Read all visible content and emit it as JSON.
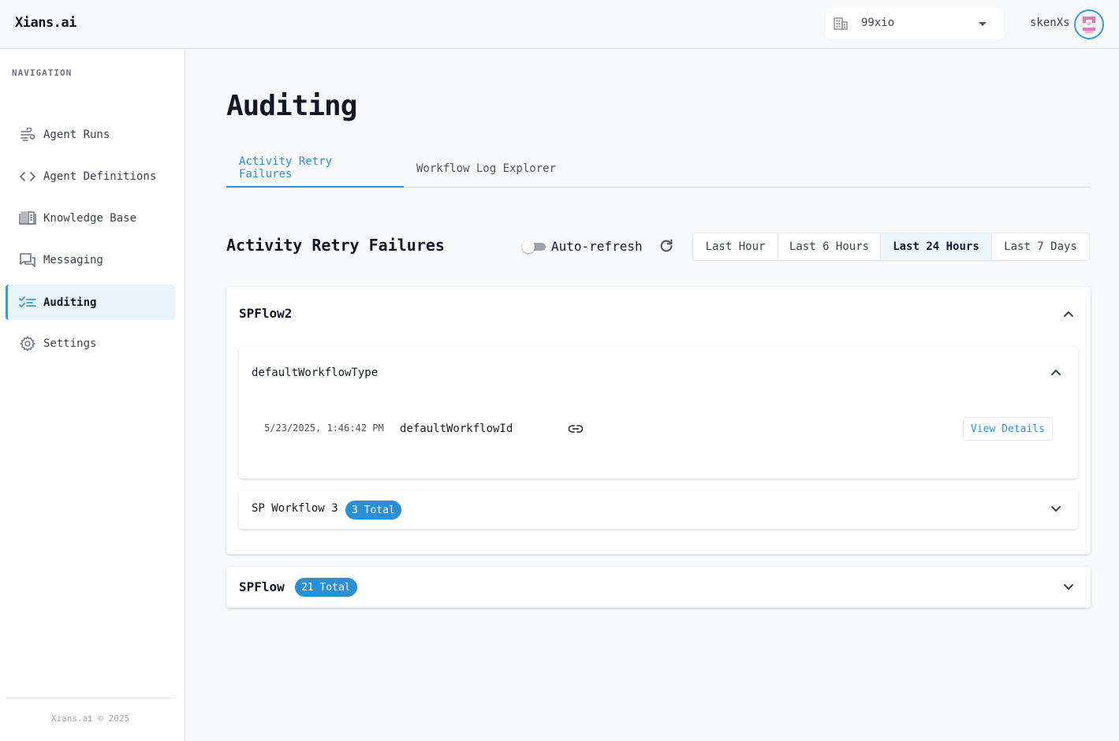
{
  "header": {
    "brand": "Xians.ai",
    "tenant": "99xio",
    "username": "skenXs"
  },
  "sidebar": {
    "title": "NAVIGATION",
    "items": [
      {
        "label": "Agent Runs",
        "icon": "wind-icon"
      },
      {
        "label": "Agent Definitions",
        "icon": "code-icon"
      },
      {
        "label": "Knowledge Base",
        "icon": "book-icon"
      },
      {
        "label": "Messaging",
        "icon": "chat-icon"
      },
      {
        "label": "Auditing",
        "icon": "checklist-icon"
      },
      {
        "label": "Settings",
        "icon": "gear-icon"
      }
    ],
    "active": "Auditing",
    "footer": "Xians.ai © 2025"
  },
  "main": {
    "title": "Auditing",
    "tabs": [
      "Activity Retry Failures",
      "Workflow Log Explorer"
    ],
    "active_tab": "Activity Retry Failures",
    "section_title": "Activity Retry Failures",
    "auto_refresh_label": "Auto-refresh",
    "auto_refresh_on": false,
    "time_ranges": [
      "Last Hour",
      "Last 6 Hours",
      "Last 24 Hours",
      "Last 7 Days"
    ],
    "selected_range": "Last 24 Hours",
    "agents": [
      {
        "name": "SPFlow2",
        "expanded": true,
        "workflow_types": [
          {
            "name": "defaultWorkflowType",
            "expanded": true,
            "runs": [
              {
                "timestamp": "5/23/2025, 1:46:42 PM",
                "workflow_id": "defaultWorkflowId",
                "action": "View Details"
              }
            ]
          },
          {
            "name": "SP Workflow 3",
            "badge": "3 Total",
            "expanded": false
          }
        ]
      },
      {
        "name": "SPFlow",
        "badge": "21 Total",
        "expanded": false
      }
    ]
  },
  "colors": {
    "accent": "#2b8fd6",
    "active_nav_bg": "#e8f3fc",
    "background": "#f8f9fa"
  }
}
